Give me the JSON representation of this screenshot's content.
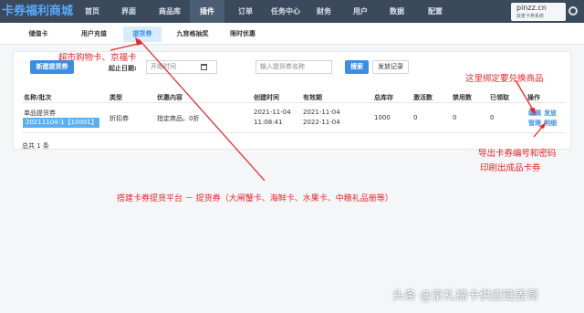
{
  "brand": "卡券福利商城",
  "nav": [
    "首页",
    "界面",
    "商品库",
    "插件",
    "订单",
    "任务中心",
    "财务",
    "用户",
    "数据",
    "配置"
  ],
  "nav_active": "插件",
  "site": {
    "domain": "pinzz.cn",
    "tagline": "获麦卡券系统"
  },
  "subtabs": [
    "储值卡",
    "用户充值",
    "提货券",
    "九宫格抽奖",
    "限时优惠"
  ],
  "subtab_active": "提货券",
  "toolbar": {
    "new_button": "新建提货券",
    "start_date_label": "起止日期:",
    "start_date_placeholder": "开始时间",
    "search_placeholder": "输入提货券名称",
    "search_button": "搜索",
    "records_button": "发放记录"
  },
  "table": {
    "headers": [
      "名称/批次",
      "类型",
      "优惠内容",
      "创建时间",
      "有效期",
      "总库存",
      "激活数",
      "禁用数",
      "已领取",
      "操作"
    ],
    "rows": [
      {
        "name": "单品提货券",
        "batch": "20211104-1【10001】",
        "type": "折扣券",
        "discount": "指定商品。0折",
        "created_date": "2021-11-04",
        "created_time": "11:08:41",
        "valid_from": "2021-11-04",
        "valid_to": "2022-11-04",
        "stock": "1000",
        "activated": "0",
        "disabled": "0",
        "received": "0",
        "actions": [
          "编辑",
          "发放",
          "管理",
          "明细"
        ]
      }
    ],
    "total": "总共 1 条"
  },
  "annotations": {
    "top": "超市购物卡、京福卡",
    "right_top": "这里绑定要兑换商品",
    "right_bottom_1": "导出卡券编号和密码",
    "right_bottom_2": "印刷出成品卡券",
    "center": "搭建卡券提货平台 － 提货券（大闸蟹卡、海鲜卡、水果卡、中粮礼品册等）",
    "color": "#e8262a"
  },
  "watermark": "头条 @京礼福卡供应链姜哥"
}
